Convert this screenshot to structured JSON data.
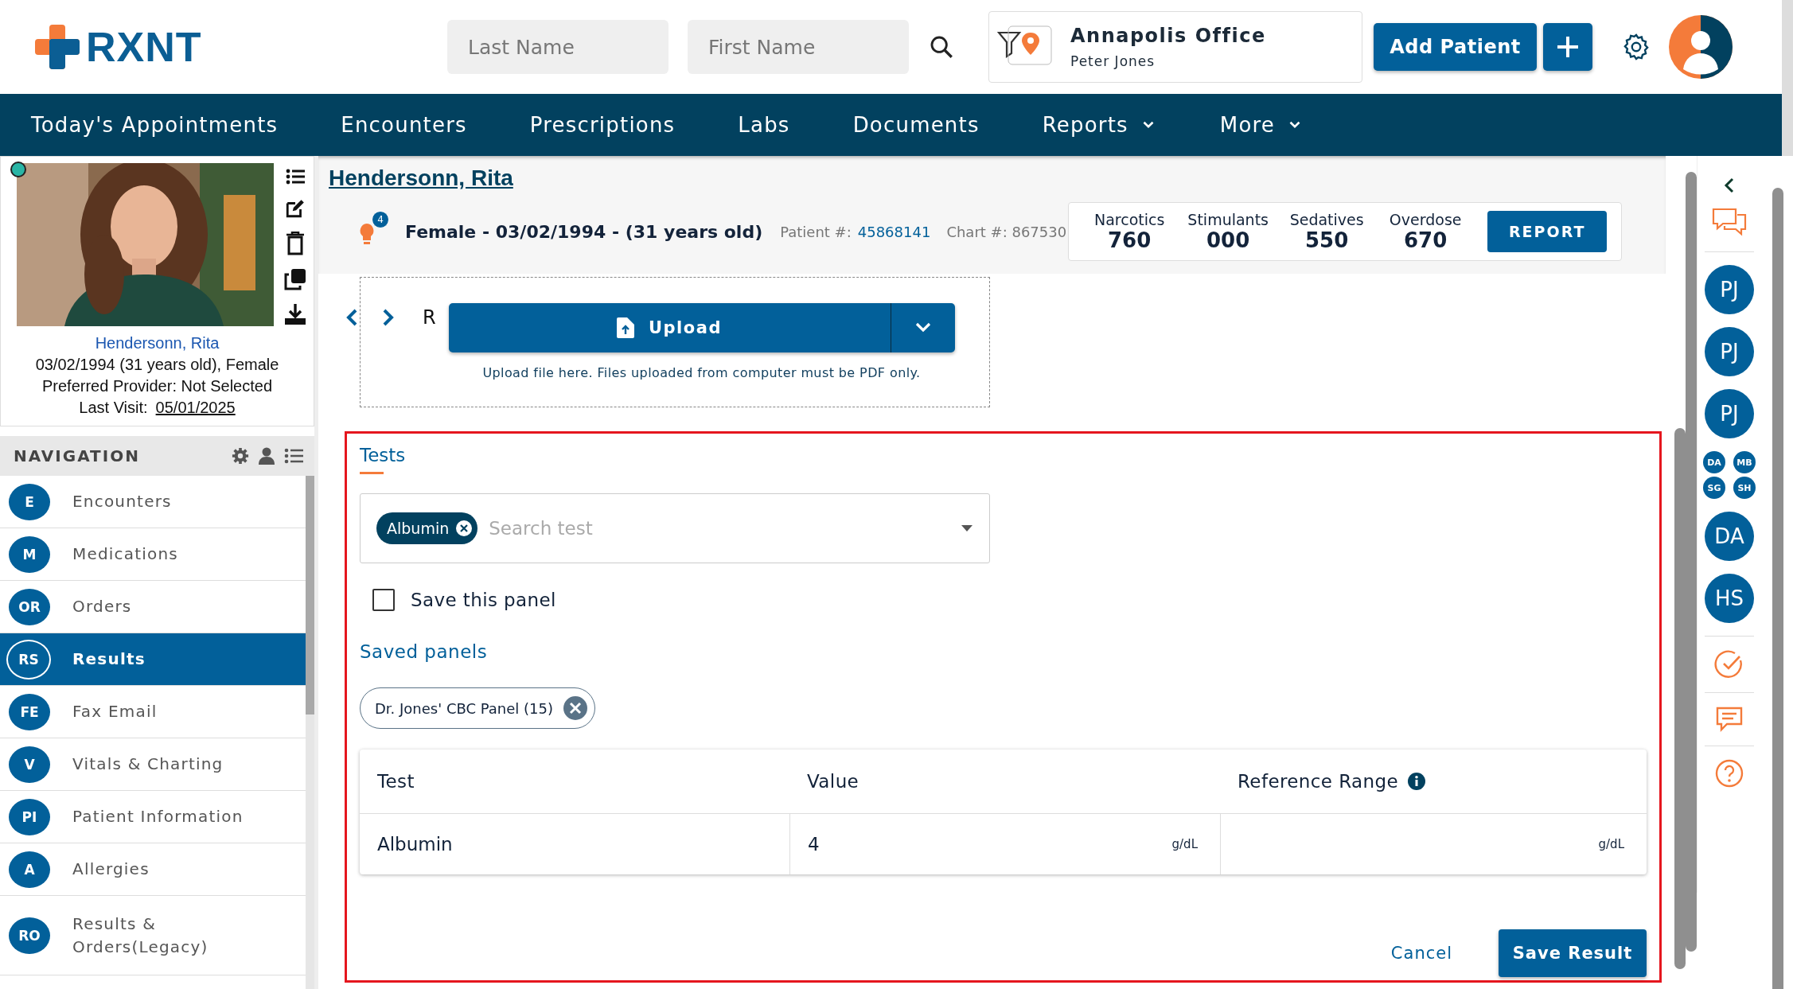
{
  "logo": {
    "text": "RXNT"
  },
  "header": {
    "search_fields": [
      {
        "placeholder": "Last Name"
      },
      {
        "placeholder": "First Name"
      }
    ],
    "office": {
      "name": "Annapolis Office",
      "user": "Peter Jones"
    },
    "add_patient": "Add Patient"
  },
  "nav_menu": [
    {
      "label": "Today's Appointments",
      "dropdown": false
    },
    {
      "label": "Encounters",
      "dropdown": false
    },
    {
      "label": "Prescriptions",
      "dropdown": false
    },
    {
      "label": "Labs",
      "dropdown": false
    },
    {
      "label": "Documents",
      "dropdown": false
    },
    {
      "label": "Reports",
      "dropdown": true
    },
    {
      "label": "More",
      "dropdown": true
    }
  ],
  "patient_card": {
    "online": true,
    "name": "Hendersonn, Rita",
    "details": "03/02/1994 (31 years old), Female",
    "provider": "Preferred Provider: Not Selected",
    "last_visit_label": "Last Visit:",
    "last_visit": "05/01/2025"
  },
  "navigation": {
    "title": "NAVIGATION",
    "items": [
      {
        "badge": "E",
        "label": "Encounters",
        "selected": false
      },
      {
        "badge": "M",
        "label": "Medications",
        "selected": false
      },
      {
        "badge": "OR",
        "label": "Orders",
        "selected": false
      },
      {
        "badge": "RS",
        "label": "Results",
        "selected": true
      },
      {
        "badge": "FE",
        "label": "Fax Email",
        "selected": false
      },
      {
        "badge": "V",
        "label": "Vitals & Charting",
        "selected": false
      },
      {
        "badge": "PI",
        "label": "Patient Information",
        "selected": false
      },
      {
        "badge": "A",
        "label": "Allergies",
        "selected": false
      },
      {
        "badge": "RO",
        "label": "Results & Orders(Legacy)",
        "selected": false
      }
    ]
  },
  "patient_header": {
    "name": "Hendersonn, Rita",
    "alerts": "4",
    "summary": "Female - 03/02/1994 - (31 years old)",
    "patient_no_label": "Patient #:",
    "patient_no": "45868141",
    "chart_label": "Chart #:",
    "chart_no": "867530"
  },
  "pdmp": {
    "stats": [
      {
        "label": "Narcotics",
        "value": "760"
      },
      {
        "label": "Stimulants",
        "value": "000"
      },
      {
        "label": "Sedatives",
        "value": "550"
      },
      {
        "label": "Overdose",
        "value": "670"
      }
    ],
    "button": "REPORT"
  },
  "upload": {
    "partial_label": "R",
    "button": "Upload",
    "hint": "Upload file here. Files uploaded from computer must be PDF only."
  },
  "tests_form": {
    "tab": "Tests",
    "selected_tests": [
      {
        "label": "Albumin"
      }
    ],
    "search_placeholder": "Search test",
    "save_panel": {
      "label": "Save this panel",
      "checked": false
    },
    "saved_panels_title": "Saved panels",
    "saved_panels": [
      {
        "label": "Dr. Jones' CBC Panel (15)"
      }
    ],
    "table": {
      "columns": [
        "Test",
        "Value",
        "Reference Range"
      ],
      "rows": [
        {
          "test": "Albumin",
          "value": "4",
          "value_unit": "g/dL",
          "range_unit": "g/dL"
        }
      ]
    },
    "cancel": "Cancel",
    "save": "Save Result"
  },
  "chat_sidebar": {
    "avatars": [
      {
        "initials": "PJ",
        "kind": "large"
      },
      {
        "initials": "PJ",
        "kind": "large"
      },
      {
        "initials": "PJ",
        "kind": "large"
      },
      {
        "initials": "DA",
        "kind": "small"
      },
      {
        "initials": "MB",
        "kind": "small"
      },
      {
        "initials": "SG",
        "kind": "small"
      },
      {
        "initials": "SH",
        "kind": "small"
      },
      {
        "initials": "DA",
        "kind": "large"
      },
      {
        "initials": "HS",
        "kind": "large"
      }
    ]
  }
}
